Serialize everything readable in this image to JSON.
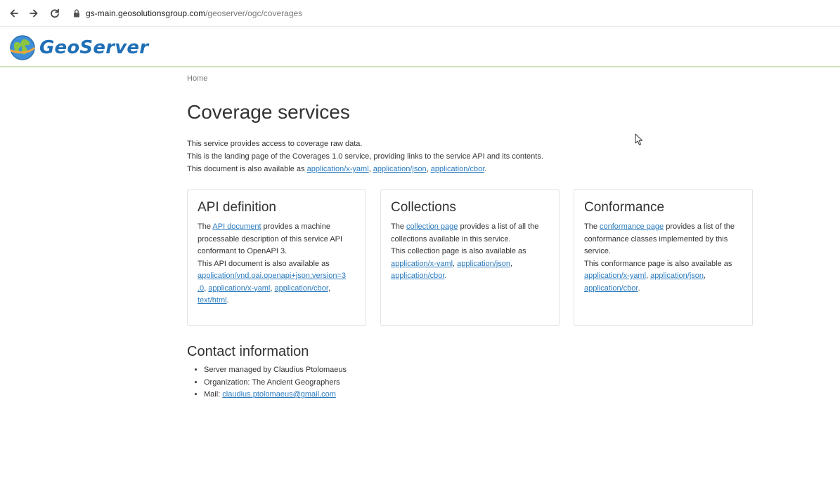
{
  "browser": {
    "url_host": "gs-main.geosolutionsgroup.com",
    "url_path": "/geoserver/ogc/coverages"
  },
  "header": {
    "logo_text": "GeoServer"
  },
  "breadcrumb": "Home",
  "page": {
    "title": "Coverage services",
    "intro_line1": "This service provides access to coverage raw data.",
    "intro_line2": "This is the landing page of the Coverages 1.0 service, providing links to the service API and its contents.",
    "intro_line3_prefix": "This document is also available as ",
    "intro_links": [
      "application/x-yaml",
      "application/json",
      "application/cbor"
    ]
  },
  "cards": {
    "api": {
      "title": "API definition",
      "text_prefix": "The ",
      "link": "API document",
      "text_rest": " provides a machine processable description of this service API conformant to OpenAPI 3.",
      "also": "This API document is also available as",
      "links": [
        "application/vnd.oai.openapi+json;version=3.0",
        "application/x-yaml",
        "application/cbor",
        "text/html"
      ]
    },
    "collections": {
      "title": "Collections",
      "text_prefix": "The ",
      "link": "collection page",
      "text_rest": " provides a list of all the collections available in this service.",
      "also": "This collection page is also available as",
      "links": [
        "application/x-yaml",
        "application/json",
        "application/cbor"
      ]
    },
    "conformance": {
      "title": "Conformance",
      "text_prefix": "The ",
      "link": "conformance page",
      "text_rest": " provides a list of the conformance classes implemented by this service.",
      "also": "This conformance page is also available as",
      "links": [
        "application/x-yaml",
        "application/json",
        "application/cbor"
      ]
    }
  },
  "contact": {
    "title": "Contact information",
    "items": {
      "manager": "Server managed by Claudius Ptolomaeus",
      "organization": "Organization: The Ancient Geographers",
      "mail_label": "Mail: ",
      "mail": "claudius.ptolomaeus@gmail.com"
    }
  },
  "icons": {
    "back": "arrow-left-icon",
    "forward": "arrow-right-icon",
    "reload": "reload-icon",
    "lock": "lock-icon",
    "logo": "globe-logo-icon",
    "cursor": "mouse-pointer-icon"
  },
  "colors": {
    "link": "#2a7bbf",
    "logo_text": "#1f6fb6",
    "header_border": "#cfe3b8"
  }
}
